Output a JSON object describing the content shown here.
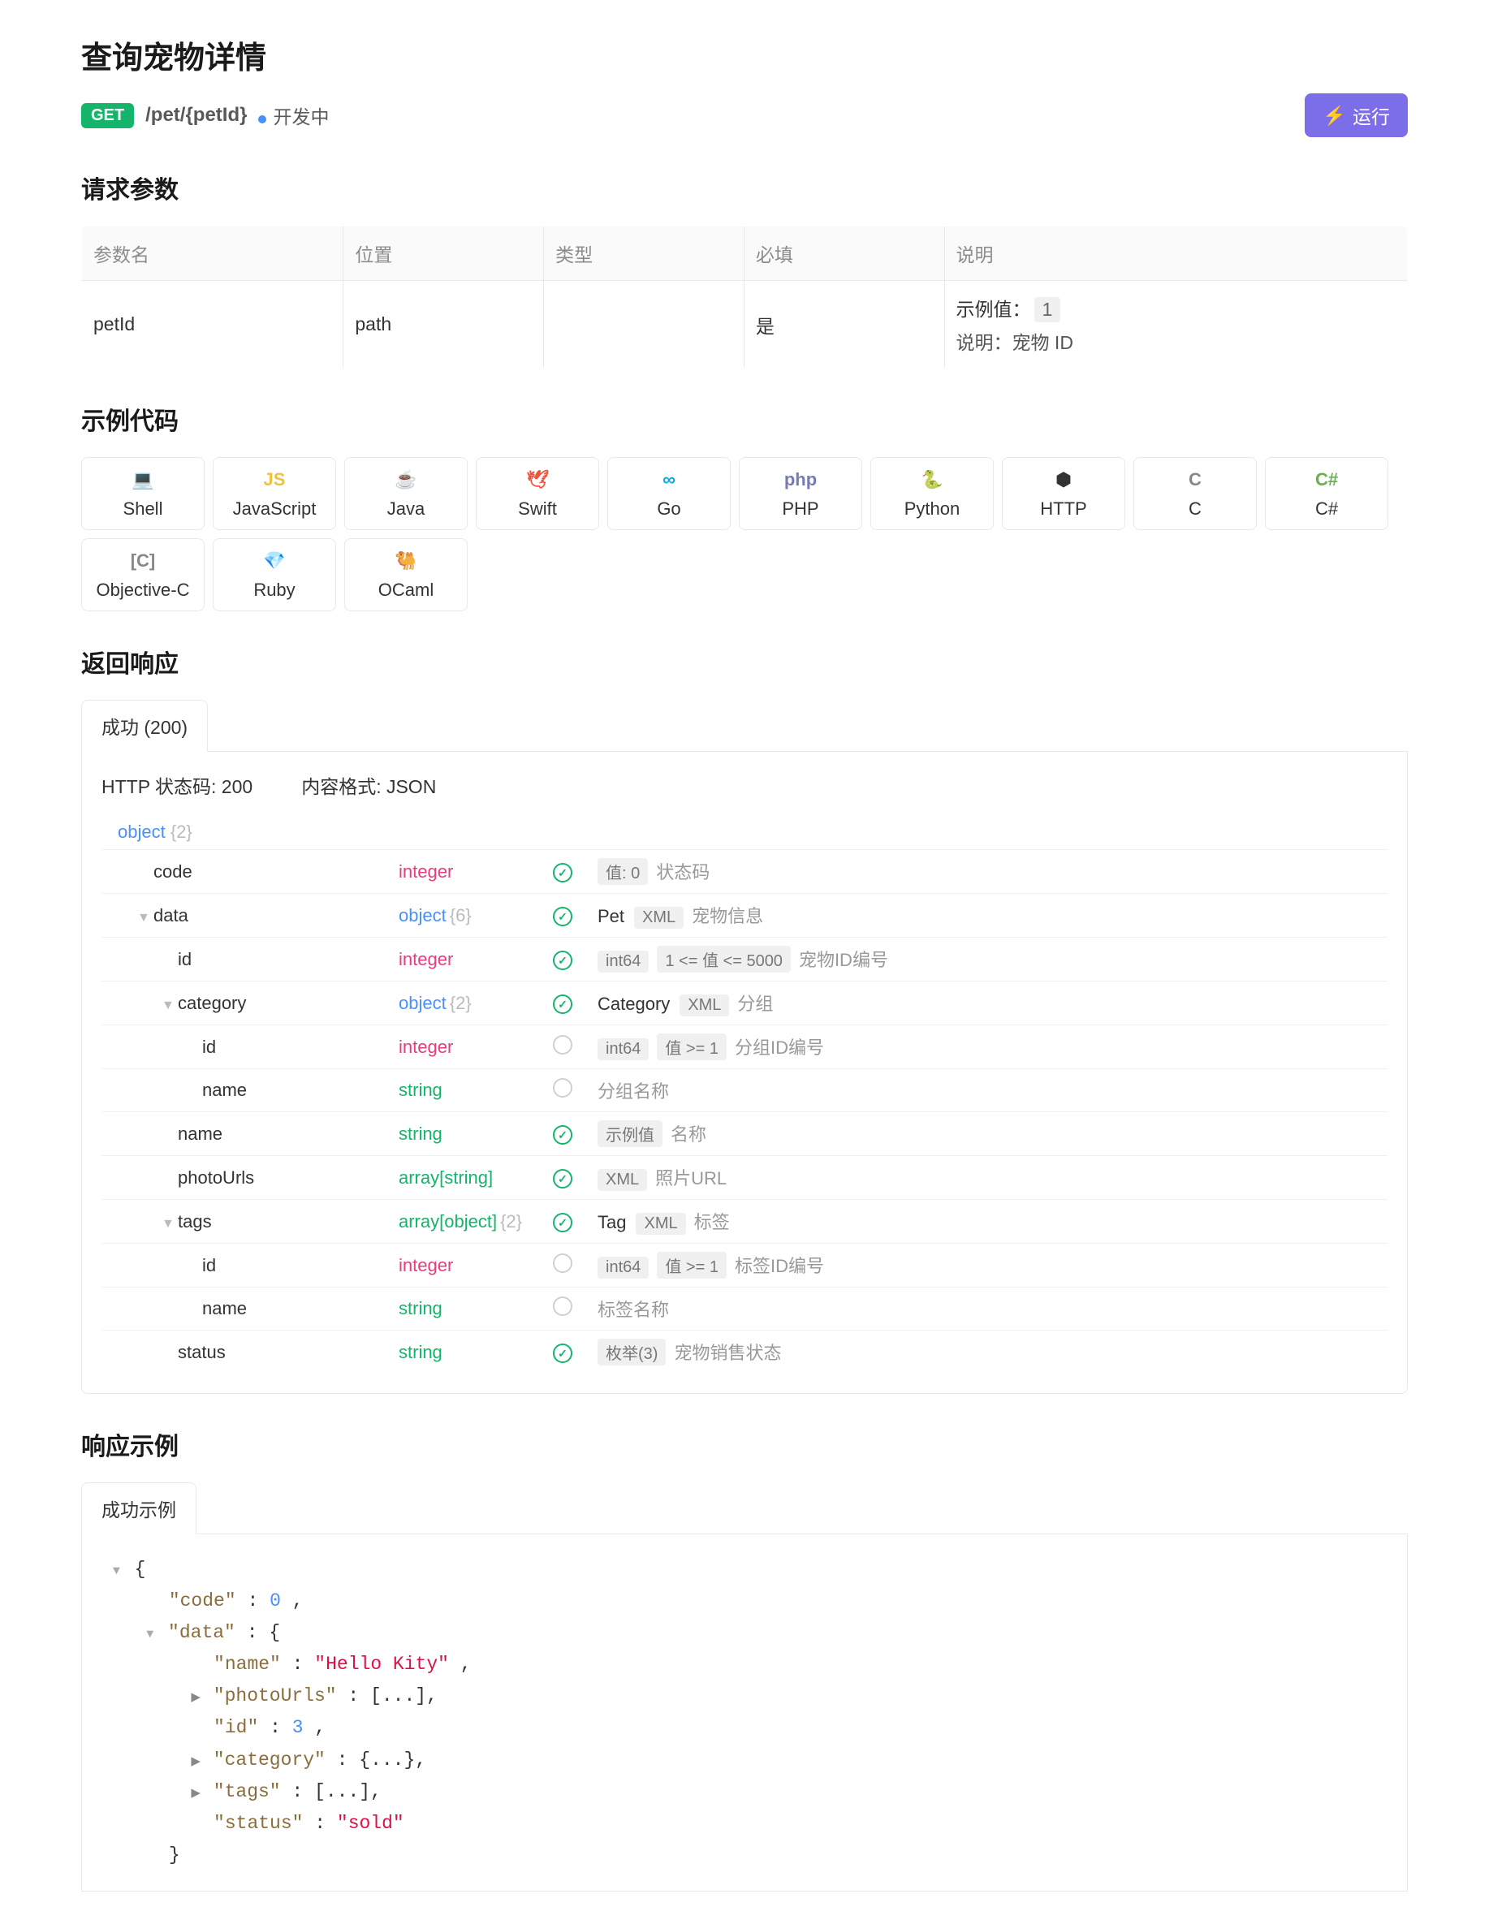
{
  "title": "查询宠物详情",
  "method": "GET",
  "path": "/pet/{petId}",
  "devStatus": "开发中",
  "runLabel": "运行",
  "sections": {
    "reqParams": "请求参数",
    "sampleCode": "示例代码",
    "response": "返回响应",
    "responseExample": "响应示例"
  },
  "paramTable": {
    "headers": {
      "name": "参数名",
      "in": "位置",
      "type": "类型",
      "required": "必填",
      "desc": "说明"
    },
    "rows": [
      {
        "name": "petId",
        "in": "path",
        "type": "",
        "required": "是",
        "exampleLabel": "示例值：",
        "exampleValue": "1",
        "descPrefix": "说明：",
        "descValue": "宠物 ID"
      }
    ]
  },
  "langs": [
    "Shell",
    "JavaScript",
    "Java",
    "Swift",
    "Go",
    "PHP",
    "Python",
    "HTTP",
    "C",
    "C#",
    "Objective-C",
    "Ruby",
    "OCaml"
  ],
  "respTab": "成功 (200)",
  "respMeta": {
    "status": "HTTP 状态码: 200",
    "format": "内容格式: JSON"
  },
  "schema": {
    "root": "object",
    "rootCount": "{2}",
    "rows": [
      {
        "indent": 1,
        "caret": "",
        "name": "code",
        "type": "integer",
        "req": true,
        "chips": [
          {
            "k": "c",
            "v": "值: 0"
          }
        ],
        "desc": "状态码"
      },
      {
        "indent": 1,
        "caret": "▼",
        "name": "data",
        "type": "object",
        "cnt": "{6}",
        "req": true,
        "chips": [
          {
            "k": "t",
            "v": "Pet"
          },
          {
            "k": "c",
            "v": "XML"
          }
        ],
        "desc": "宠物信息"
      },
      {
        "indent": 2,
        "caret": "",
        "name": "id",
        "type": "integer",
        "req": true,
        "chips": [
          {
            "k": "c",
            "v": "int64"
          },
          {
            "k": "c",
            "v": "1 <= 值 <= 5000"
          }
        ],
        "desc": "宠物ID编号"
      },
      {
        "indent": 2,
        "caret": "▼",
        "name": "category",
        "type": "object",
        "cnt": "{2}",
        "req": true,
        "chips": [
          {
            "k": "t",
            "v": "Category"
          },
          {
            "k": "c",
            "v": "XML"
          }
        ],
        "desc": "分组"
      },
      {
        "indent": 3,
        "caret": "",
        "name": "id",
        "type": "integer",
        "req": false,
        "chips": [
          {
            "k": "c",
            "v": "int64"
          },
          {
            "k": "c",
            "v": "值 >= 1"
          }
        ],
        "desc": "分组ID编号"
      },
      {
        "indent": 3,
        "caret": "",
        "name": "name",
        "type": "string",
        "req": false,
        "chips": [],
        "desc": "分组名称"
      },
      {
        "indent": 2,
        "caret": "",
        "name": "name",
        "type": "string",
        "req": true,
        "chips": [
          {
            "k": "c",
            "v": "示例值"
          }
        ],
        "desc": "名称"
      },
      {
        "indent": 2,
        "caret": "",
        "name": "photoUrls",
        "type": "array[string]",
        "req": true,
        "chips": [
          {
            "k": "c",
            "v": "XML"
          }
        ],
        "desc": "照片URL"
      },
      {
        "indent": 2,
        "caret": "▼",
        "name": "tags",
        "type": "array[object]",
        "cnt": "{2}",
        "req": true,
        "chips": [
          {
            "k": "t",
            "v": "Tag"
          },
          {
            "k": "c",
            "v": "XML"
          }
        ],
        "desc": "标签"
      },
      {
        "indent": 3,
        "caret": "",
        "name": "id",
        "type": "integer",
        "req": false,
        "chips": [
          {
            "k": "c",
            "v": "int64"
          },
          {
            "k": "c",
            "v": "值 >= 1"
          }
        ],
        "desc": "标签ID编号"
      },
      {
        "indent": 3,
        "caret": "",
        "name": "name",
        "type": "string",
        "req": false,
        "chips": [],
        "desc": "标签名称"
      },
      {
        "indent": 2,
        "caret": "",
        "name": "status",
        "type": "string",
        "req": true,
        "chips": [
          {
            "k": "c",
            "v": "枚举(3)"
          }
        ],
        "desc": "宠物销售状态"
      }
    ]
  },
  "exampleTab": "成功示例",
  "exampleJson": {
    "code": 0,
    "data": {
      "name": "Hello Kity",
      "photoUrls": "[...]",
      "id": 3,
      "category": "{...}",
      "tags": "[...]",
      "status": "sold"
    }
  }
}
